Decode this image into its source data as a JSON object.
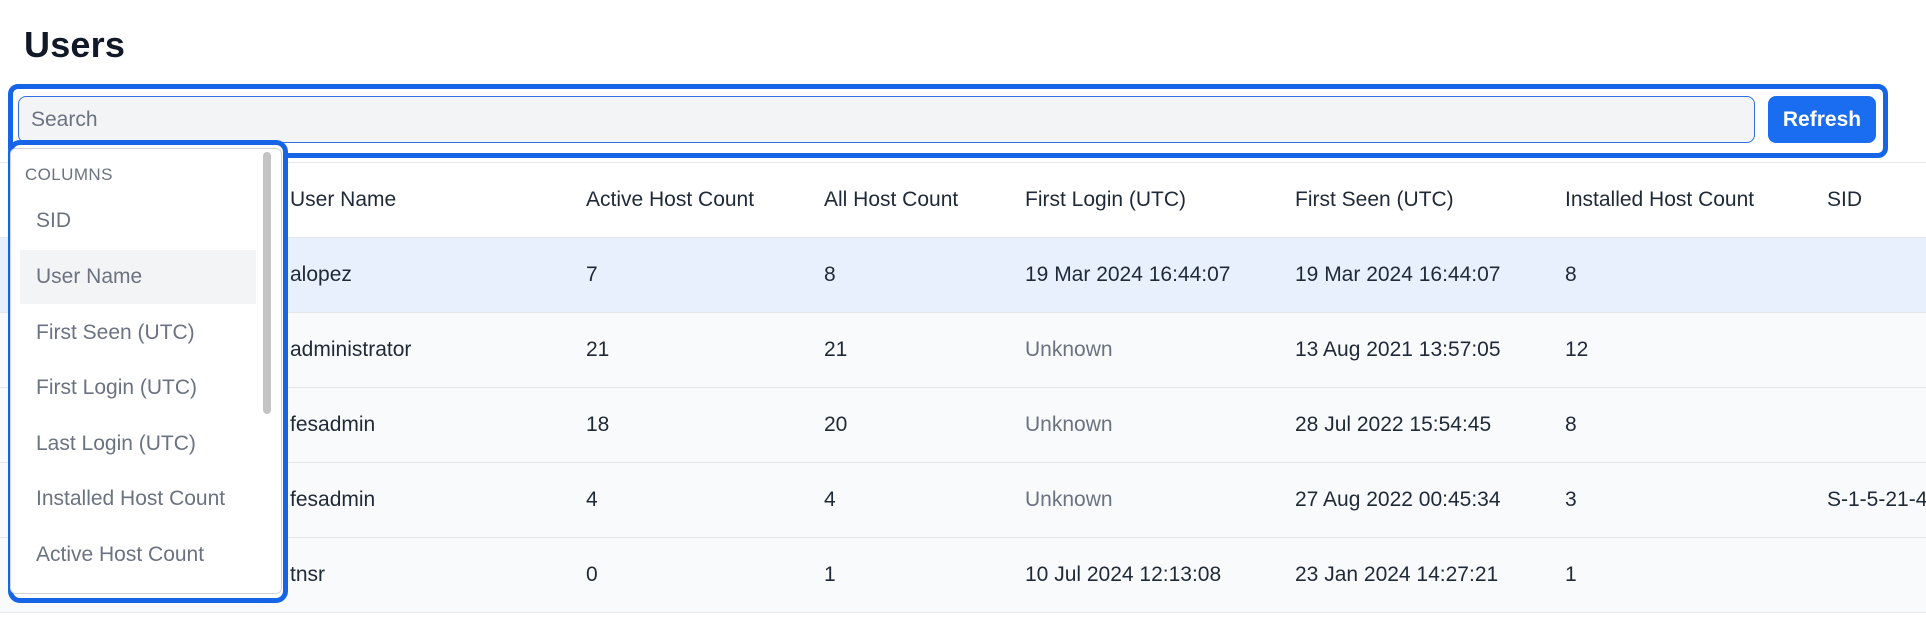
{
  "page": {
    "title": "Users"
  },
  "toolbar": {
    "search_placeholder": "Search",
    "search_value": "",
    "refresh_label": "Refresh"
  },
  "table": {
    "headers": [
      "User Name",
      "Active Host Count",
      "All Host Count",
      "First Login (UTC)",
      "First Seen (UTC)",
      "Installed Host Count",
      "SID"
    ],
    "rows": [
      {
        "user_name": "alopez",
        "active_host_count": "7",
        "all_host_count": "8",
        "first_login": "19 Mar 2024 16:44:07",
        "first_seen": "19 Mar 2024 16:44:07",
        "installed_host_count": "8",
        "sid": "",
        "selected": true
      },
      {
        "user_name": "administrator",
        "active_host_count": "21",
        "all_host_count": "21",
        "first_login": "Unknown",
        "first_seen": "13 Aug 2021 13:57:05",
        "installed_host_count": "12",
        "sid": ""
      },
      {
        "user_name": "fesadmin",
        "active_host_count": "18",
        "all_host_count": "20",
        "first_login": "Unknown",
        "first_seen": "28 Jul 2022 15:54:45",
        "installed_host_count": "8",
        "sid": ""
      },
      {
        "user_name": "fesadmin",
        "active_host_count": "4",
        "all_host_count": "4",
        "first_login": "Unknown",
        "first_seen": "27 Aug 2022 00:45:34",
        "installed_host_count": "3",
        "sid": "S-1-5-21-4"
      },
      {
        "user_name": "tnsr",
        "active_host_count": "0",
        "all_host_count": "1",
        "first_login": "10 Jul 2024 12:13:08",
        "first_seen": "23 Jan 2024 14:27:21",
        "installed_host_count": "1",
        "sid": ""
      }
    ]
  },
  "column_menu": {
    "heading": "COLUMNS",
    "items": [
      "SID",
      "User Name",
      "First Seen (UTC)",
      "First Login (UTC)",
      "Last Login (UTC)",
      "Installed Host Count",
      "Active Host Count"
    ],
    "hovered_item": "User Name"
  },
  "colors": {
    "accent": "#1a6cf0",
    "highlight_border": "#1565e6",
    "selected_row": "#e8f0fd"
  }
}
